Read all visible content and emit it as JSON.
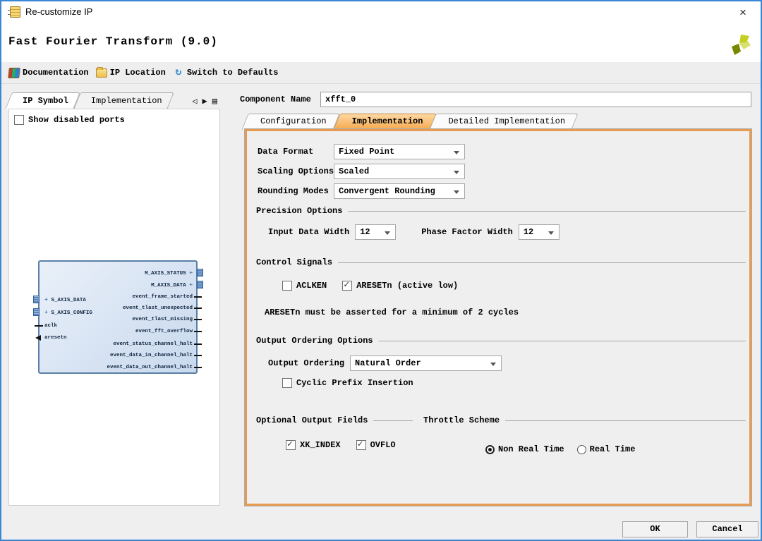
{
  "window": {
    "title": "Re-customize IP",
    "close_glyph": "×"
  },
  "header": {
    "title": "Fast Fourier Transform (9.0)"
  },
  "toolbar": {
    "items": [
      {
        "label": "Documentation",
        "icon": "books-icon"
      },
      {
        "label": "IP Location",
        "icon": "folder-icon"
      },
      {
        "label": "Switch to Defaults",
        "icon": "refresh-icon"
      }
    ],
    "refresh_glyph": "↻"
  },
  "left_panel": {
    "tabs": [
      {
        "label": "IP Symbol",
        "active": true
      },
      {
        "label": "Implementation",
        "active": false
      }
    ],
    "nav": {
      "prev_glyph": "◁",
      "next_glyph": "▶",
      "list_glyph": "▤"
    },
    "show_disabled_ports_label": "Show disabled ports",
    "ip_symbol": {
      "left_ports": [
        "S_AXIS_DATA",
        "S_AXIS_CONFIG",
        "aclk",
        "aresetn"
      ],
      "right_ports": [
        "M_AXIS_STATUS",
        "M_AXIS_DATA",
        "event_frame_started",
        "event_tlast_unexpected",
        "event_tlast_missing",
        "event_fft_overflow",
        "event_status_channel_halt",
        "event_data_in_channel_halt",
        "event_data_out_channel_halt"
      ],
      "expand_glyph": "+"
    }
  },
  "component_name": {
    "label": "Component Name",
    "value": "xfft_0"
  },
  "main_tabs": [
    {
      "label": "Configuration",
      "active": false
    },
    {
      "label": "Implementation",
      "active": true
    },
    {
      "label": "Detailed Implementation",
      "active": false
    }
  ],
  "form": {
    "data_format": {
      "label": "Data Format",
      "value": "Fixed Point"
    },
    "scaling_options": {
      "label": "Scaling Options",
      "value": "Scaled"
    },
    "rounding_modes": {
      "label": "Rounding Modes",
      "value": "Convergent Rounding"
    },
    "precision_section": "Precision Options",
    "input_data_width": {
      "label": "Input Data Width",
      "value": "12"
    },
    "phase_factor_width": {
      "label": "Phase Factor Width",
      "value": "12"
    },
    "control_section": "Control Signals",
    "aclken": {
      "label": "ACLKEN",
      "checked": false
    },
    "aresetn": {
      "label": "ARESETn (active low)",
      "checked": true
    },
    "aresetn_note": "ARESETn must be asserted for a minimum of 2 cycles",
    "output_ordering_section": "Output Ordering Options",
    "output_ordering": {
      "label": "Output Ordering",
      "value": "Natural Order"
    },
    "cyclic_prefix": {
      "label": "Cyclic Prefix Insertion",
      "checked": false
    },
    "optional_fields_section": "Optional Output Fields",
    "throttle_section": "Throttle Scheme",
    "xk_index": {
      "label": "XK_INDEX",
      "checked": true
    },
    "ovflo": {
      "label": "OVFLO",
      "checked": true
    },
    "throttle_options": [
      {
        "label": "Non Real Time",
        "selected": true
      },
      {
        "label": "Real Time",
        "selected": false
      }
    ]
  },
  "footer": {
    "ok_label": "OK",
    "cancel_label": "Cancel"
  },
  "colors": {
    "window_border_blue": "#3a86d6",
    "active_tab_orange": "#f6a94e",
    "panel_border_orange": "#e89a50",
    "ip_block_fill": "#d6e3f3",
    "ip_block_border": "#5b7fa6"
  }
}
